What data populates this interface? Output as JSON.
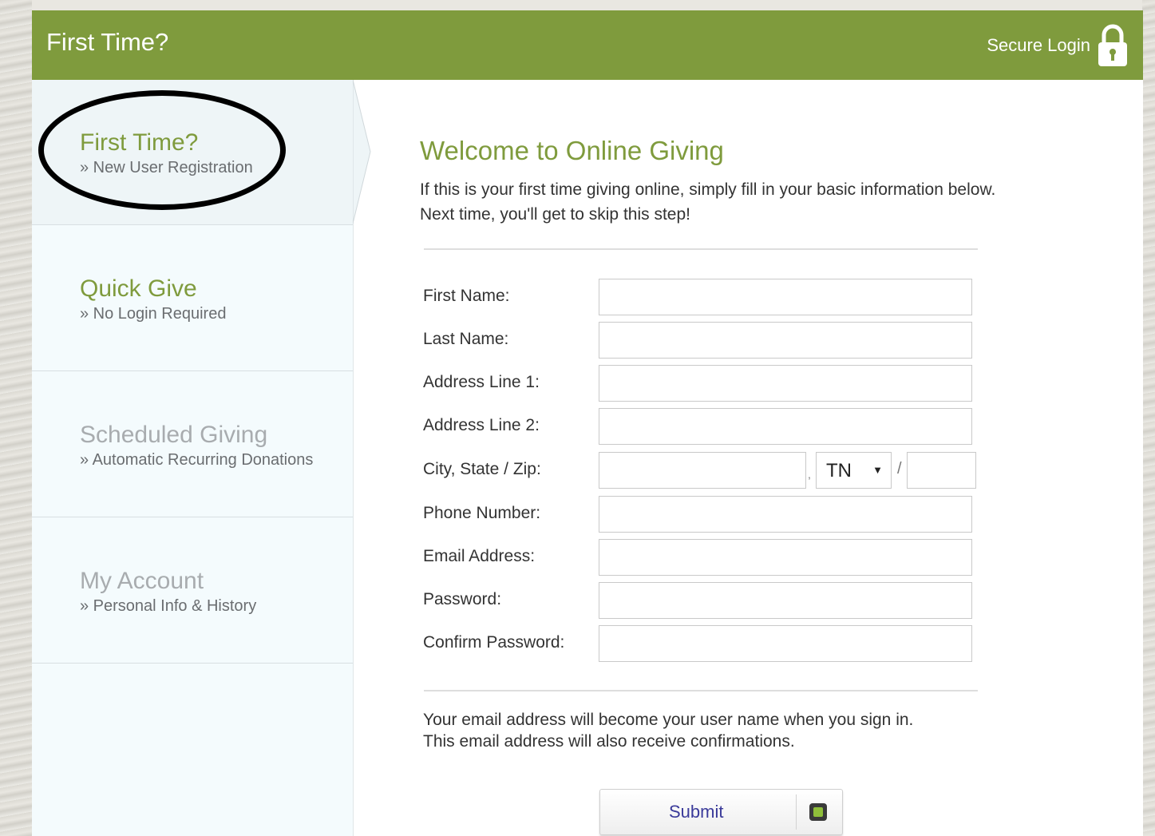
{
  "header": {
    "title": "First Time?",
    "secure_label": "Secure Login",
    "color": "#7f9b3d"
  },
  "sidebar": {
    "items": [
      {
        "title": "First Time?",
        "subtitle": "» New User Registration",
        "state": "active"
      },
      {
        "title": "Quick Give",
        "subtitle": "» No Login Required",
        "state": "enabled"
      },
      {
        "title": "Scheduled Giving",
        "subtitle": "» Automatic Recurring Donations",
        "state": "disabled"
      },
      {
        "title": "My Account",
        "subtitle": "» Personal Info & History",
        "state": "disabled"
      }
    ]
  },
  "main": {
    "welcome": "Welcome to Online Giving",
    "intro_line1": "If this is your first time giving online, simply fill in your basic information below.",
    "intro_line2": "Next time, you'll get to skip this step!",
    "fields": {
      "first_name": "First Name:",
      "last_name": "Last Name:",
      "address1": "Address Line 1:",
      "address2": "Address Line 2:",
      "city_state_zip": "City, State / Zip:",
      "phone": "Phone Number:",
      "email": "Email Address:",
      "password": "Password:",
      "confirm_password": "Confirm Password:"
    },
    "state_value": "TN",
    "comma": ",",
    "slash": "/",
    "note_line1": "Your email address will become your user name when you sign in.",
    "note_line2": "This email address will also receive confirmations.",
    "submit_label": "Submit"
  }
}
